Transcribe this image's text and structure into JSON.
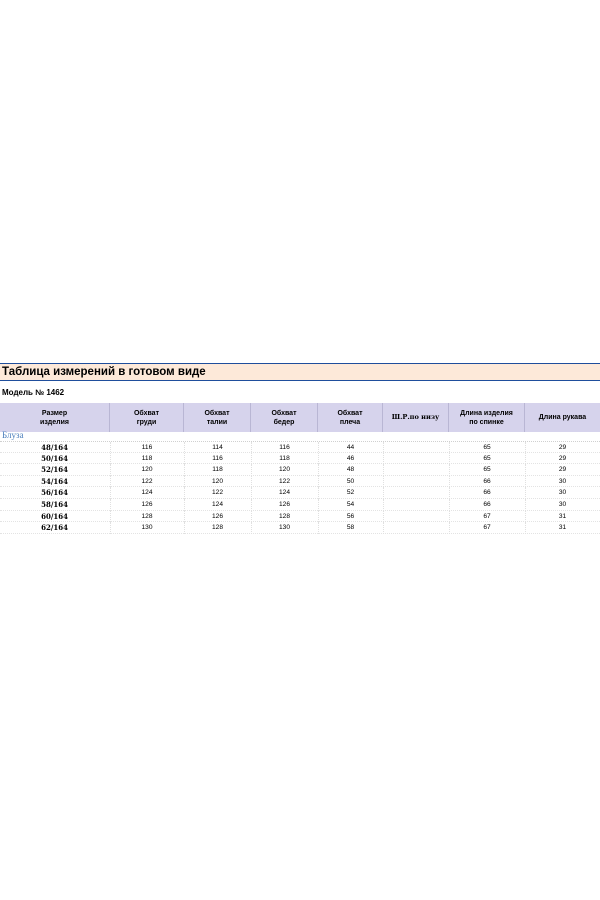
{
  "title": "Таблица измерений в готовом виде",
  "model": "Модель № 1462",
  "section": "Блуза",
  "headers": [
    [
      "Размер",
      "изделия"
    ],
    [
      "Обхват",
      "груди"
    ],
    [
      "Обхват",
      "талии"
    ],
    [
      "Обхват",
      "бедер"
    ],
    [
      "Обхват",
      "плеча"
    ],
    [
      "Ш.Р.по низу"
    ],
    [
      "Длина изделия",
      "по спинке"
    ],
    [
      "Длина рукава"
    ]
  ],
  "rows": [
    {
      "size": "48/164",
      "chest": "116",
      "waist": "114",
      "hips": "116",
      "shoulder": "44",
      "hem": "",
      "back_length": "65",
      "sleeve": "29"
    },
    {
      "size": "50/164",
      "chest": "118",
      "waist": "116",
      "hips": "118",
      "shoulder": "46",
      "hem": "",
      "back_length": "65",
      "sleeve": "29"
    },
    {
      "size": "52/164",
      "chest": "120",
      "waist": "118",
      "hips": "120",
      "shoulder": "48",
      "hem": "",
      "back_length": "65",
      "sleeve": "29"
    },
    {
      "size": "54/164",
      "chest": "122",
      "waist": "120",
      "hips": "122",
      "shoulder": "50",
      "hem": "",
      "back_length": "66",
      "sleeve": "30"
    },
    {
      "size": "56/164",
      "chest": "124",
      "waist": "122",
      "hips": "124",
      "shoulder": "52",
      "hem": "",
      "back_length": "66",
      "sleeve": "30"
    },
    {
      "size": "58/164",
      "chest": "126",
      "waist": "124",
      "hips": "126",
      "shoulder": "54",
      "hem": "",
      "back_length": "66",
      "sleeve": "30"
    },
    {
      "size": "60/164",
      "chest": "128",
      "waist": "126",
      "hips": "128",
      "shoulder": "56",
      "hem": "",
      "back_length": "67",
      "sleeve": "31"
    },
    {
      "size": "62/164",
      "chest": "130",
      "waist": "128",
      "hips": "130",
      "shoulder": "58",
      "hem": "",
      "back_length": "67",
      "sleeve": "31"
    }
  ],
  "colors": {
    "title_bg": "#fde9d9",
    "title_border": "#1f4e9c",
    "header_bg": "#d6d3ec",
    "section_text": "#4f81bd"
  }
}
